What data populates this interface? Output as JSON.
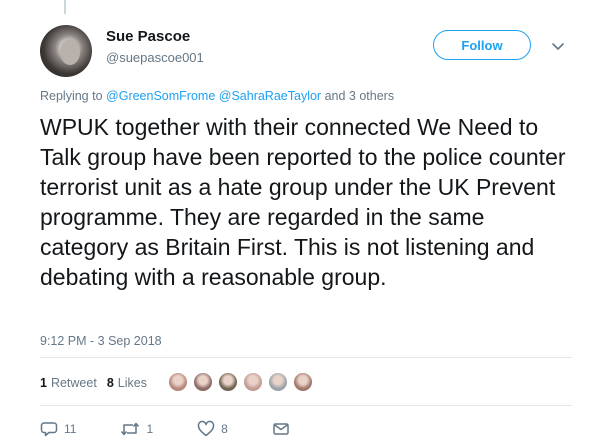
{
  "author": {
    "display_name": "Sue Pascoe",
    "handle": "@suepascoe001"
  },
  "follow_button": {
    "label": "Follow"
  },
  "reply_context": {
    "prefix": "Replying to",
    "mention_1": "@GreenSomFrome",
    "mention_2": "@SahraRaeTaylor",
    "suffix": "and 3 others"
  },
  "tweet": {
    "text": "WPUK together with their connected We Need to Talk group have been reported to the police counter terrorist unit as a hate group under the UK Prevent programme. They are regarded in the same category as Britain First. This is not listening and debating with a reasonable group.",
    "timestamp": "9:12 PM - 3 Sep 2018"
  },
  "stats": {
    "retweets_count": "1",
    "retweets_label": "Retweet",
    "likes_count": "8",
    "likes_label": "Likes"
  },
  "likers": [
    {
      "icon": "liker-avatar",
      "color": "#b7867a"
    },
    {
      "icon": "liker-avatar",
      "color": "#8d6a66"
    },
    {
      "icon": "liker-avatar",
      "color": "#6e6450"
    },
    {
      "icon": "liker-avatar",
      "color": "#c49a94"
    },
    {
      "icon": "liker-avatar",
      "color": "#9aa3a8"
    },
    {
      "icon": "liker-avatar",
      "color": "#a0786a"
    }
  ],
  "actions": {
    "reply_icon": "reply-icon",
    "reply_count": "11",
    "retweet_icon": "retweet-icon",
    "retweet_count": "1",
    "like_icon": "heart-icon",
    "like_count": "8",
    "message_icon": "envelope-icon"
  },
  "colors": {
    "accent": "#1da1f2",
    "secondary_text": "#657786",
    "primary_text": "#14171a"
  }
}
